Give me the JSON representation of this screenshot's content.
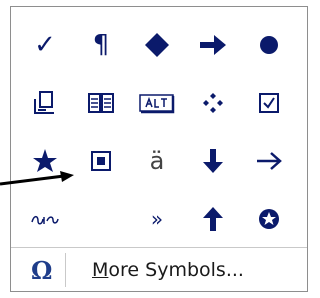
{
  "colors": {
    "symbol": "#0b1a6b",
    "omega": "#1f3d8a",
    "border": "#8e8e8e"
  },
  "symbols": {
    "checkmark": "✓",
    "pilcrow": "¶",
    "a_umlaut": "ä",
    "guillemet": "»"
  },
  "footer": {
    "omega": "Ω",
    "more_first": "M",
    "more_rest": "ore Symbols..."
  },
  "icons": [
    "checkmark-icon",
    "pilcrow-icon",
    "diamond-icon",
    "right-arrow-bold-icon",
    "bullet-circle-icon",
    "sign-form-icon",
    "key-icon",
    "alt-key-icon",
    "four-diamonds-icon",
    "checkbox-icon",
    "star-icon",
    "boxed-square-icon",
    "a-umlaut-icon",
    "down-arrow-icon",
    "right-arrow-thin-icon",
    "sign-form-icon",
    "guillemet-icon",
    "up-arrow-icon",
    "star-circle-icon"
  ]
}
